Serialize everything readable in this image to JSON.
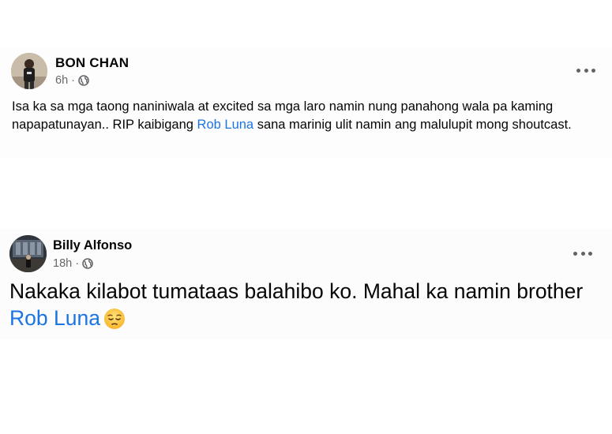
{
  "posts": [
    {
      "author": "BON CHAN",
      "time": "6h",
      "separator": "·",
      "privacy_icon": "globe-icon",
      "body_before": "Isa ka sa mga taong naniniwala at excited sa mga laro namin nung panahong wala pa kaming napapatunayan.. RIP kaibigang ",
      "mention": "Rob Luna",
      "body_after": " sana marinig ulit namin ang malulupit mong shoutcast."
    },
    {
      "author": "Billy Alfonso",
      "time": "18h",
      "separator": "·",
      "privacy_icon": "globe-icon",
      "body_before": "Nakaka kilabot tumataas balahibo ko. Mahal ka namin brother ",
      "mention": "Rob Luna",
      "emoji": "pensive-face-emoji"
    }
  ],
  "colors": {
    "mention": "#1b74e4",
    "meta": "#65676b",
    "text": "#050505"
  }
}
